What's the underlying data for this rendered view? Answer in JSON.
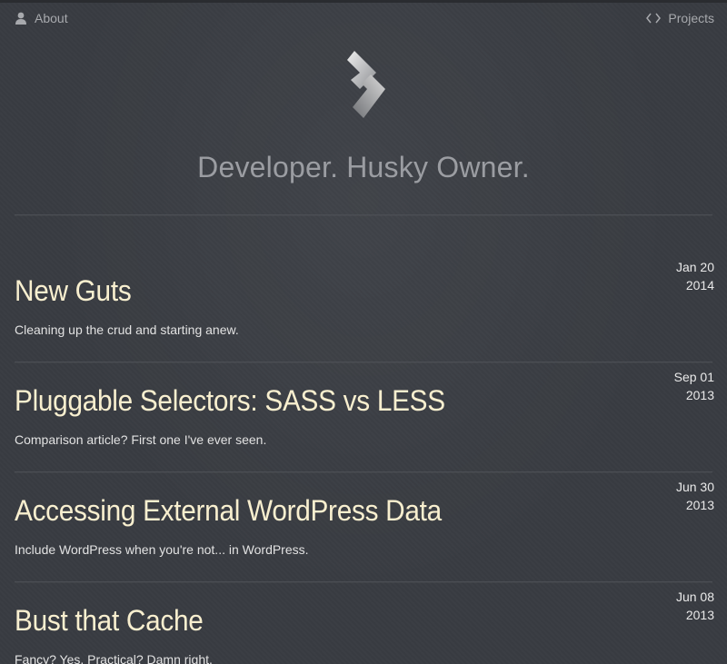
{
  "nav": {
    "about_label": "About",
    "projects_label": "Projects"
  },
  "header": {
    "tagline": "Developer. Husky Owner."
  },
  "posts": [
    {
      "title": "New Guts",
      "date_month_day": "Jan 20",
      "date_year": "2014",
      "excerpt": "Cleaning up the crud and starting anew."
    },
    {
      "title": "Pluggable Selectors: SASS vs LESS",
      "date_month_day": "Sep 01",
      "date_year": "2013",
      "excerpt": "Comparison article? First one I've ever seen."
    },
    {
      "title": "Accessing External WordPress Data",
      "date_month_day": "Jun 30",
      "date_year": "2013",
      "excerpt": "Include WordPress when you're not... in WordPress."
    },
    {
      "title": "Bust that Cache",
      "date_month_day": "Jun 08",
      "date_year": "2013",
      "excerpt": "Fancy? Yes. Practical? Damn right."
    }
  ],
  "colors": {
    "background": "#393c42",
    "title": "#f8efcf",
    "muted": "#a7a9ad"
  },
  "icons": {
    "about": "user-icon",
    "projects": "code-brackets-icon",
    "logo": "site-logo"
  }
}
